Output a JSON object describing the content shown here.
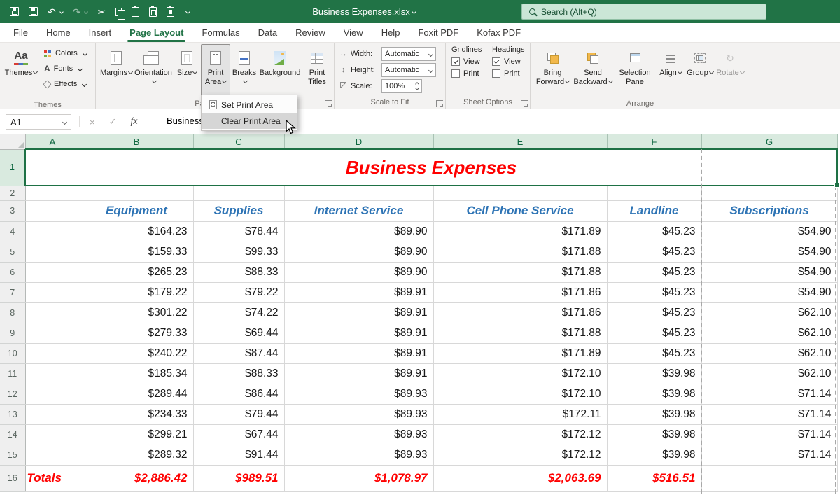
{
  "titlebar": {
    "title": "Business Expenses.xlsx",
    "search_placeholder": "Search (Alt+Q)"
  },
  "tabs": [
    "File",
    "Home",
    "Insert",
    "Page Layout",
    "Formulas",
    "Data",
    "Review",
    "View",
    "Help",
    "Foxit PDF",
    "Kofax PDF"
  ],
  "active_tab": "Page Layout",
  "icons": {
    "themes_aa": "Aa",
    "undo": "↶",
    "redo": "↷",
    "cut": "✂",
    "fonts": "A",
    "width_arrow": "↔",
    "height_arrow": "↕",
    "rotate": "↻",
    "cancel": "×",
    "enter": "✓"
  },
  "ribbon": {
    "themes": {
      "group_label": "Themes",
      "themes_button": "Themes",
      "colors": "Colors",
      "fonts": "Fonts",
      "effects": "Effects"
    },
    "page_setup": {
      "group_label": "Page Setup",
      "margins": "Margins",
      "orientation": "Orientation",
      "size": "Size",
      "print_area": "Print Area",
      "breaks": "Breaks",
      "background": "Background",
      "print_titles": "Print Titles"
    },
    "scale_to_fit": {
      "group_label": "Scale to Fit",
      "width_label": "Width:",
      "width_value": "Automatic",
      "height_label": "Height:",
      "height_value": "Automatic",
      "scale_label": "Scale:",
      "scale_value": "100%"
    },
    "sheet_options": {
      "group_label": "Sheet Options",
      "gridlines_label": "Gridlines",
      "headings_label": "Headings",
      "view_label": "View",
      "print_label": "Print",
      "gridlines_view_checked": true,
      "gridlines_print_checked": false,
      "headings_view_checked": true,
      "headings_print_checked": false
    },
    "arrange": {
      "group_label": "Arrange",
      "bring_forward": "Bring Forward",
      "send_backward": "Send Backward",
      "selection_pane": "Selection Pane",
      "align": "Align",
      "group": "Group",
      "rotate": "Rotate"
    }
  },
  "formula_bar": {
    "name_box": "A1",
    "fx": "fx",
    "value": "Business Expenses"
  },
  "print_area_menu": {
    "items": [
      {
        "accel": "S",
        "rest": "et Print Area",
        "highlighted": false
      },
      {
        "accel": "C",
        "rest": "lear Print Area",
        "highlighted": true
      }
    ]
  },
  "sheet": {
    "columns": [
      "A",
      "B",
      "C",
      "D",
      "E",
      "F",
      "G"
    ],
    "rows": [
      {
        "num": "1",
        "type": "title",
        "selected": true,
        "cells": [
          "Business Expenses"
        ]
      },
      {
        "num": "2",
        "type": "blank",
        "cells": [
          "",
          "",
          "",
          "",
          "",
          "",
          ""
        ]
      },
      {
        "num": "3",
        "type": "colhead",
        "cells": [
          "",
          "Equipment",
          "Supplies",
          "Internet Service",
          "Cell Phone Service",
          "Landline",
          "Subscriptions"
        ]
      },
      {
        "num": "4",
        "type": "data",
        "cells": [
          "",
          "$164.23",
          "$78.44",
          "$89.90",
          "$171.89",
          "$45.23",
          "$54.90"
        ]
      },
      {
        "num": "5",
        "type": "data",
        "cells": [
          "",
          "$159.33",
          "$99.33",
          "$89.90",
          "$171.88",
          "$45.23",
          "$54.90"
        ]
      },
      {
        "num": "6",
        "type": "data",
        "cells": [
          "",
          "$265.23",
          "$88.33",
          "$89.90",
          "$171.88",
          "$45.23",
          "$54.90"
        ]
      },
      {
        "num": "7",
        "type": "data",
        "cells": [
          "",
          "$179.22",
          "$79.22",
          "$89.91",
          "$171.86",
          "$45.23",
          "$54.90"
        ]
      },
      {
        "num": "8",
        "type": "data",
        "cells": [
          "",
          "$301.22",
          "$74.22",
          "$89.91",
          "$171.86",
          "$45.23",
          "$62.10"
        ]
      },
      {
        "num": "9",
        "type": "data",
        "cells": [
          "",
          "$279.33",
          "$69.44",
          "$89.91",
          "$171.88",
          "$45.23",
          "$62.10"
        ]
      },
      {
        "num": "10",
        "type": "data",
        "cells": [
          "",
          "$240.22",
          "$87.44",
          "$89.91",
          "$171.89",
          "$45.23",
          "$62.10"
        ]
      },
      {
        "num": "11",
        "type": "data",
        "cells": [
          "",
          "$185.34",
          "$88.33",
          "$89.91",
          "$172.10",
          "$39.98",
          "$62.10"
        ]
      },
      {
        "num": "12",
        "type": "data",
        "cells": [
          "",
          "$289.44",
          "$86.44",
          "$89.93",
          "$172.10",
          "$39.98",
          "$71.14"
        ]
      },
      {
        "num": "13",
        "type": "data",
        "cells": [
          "",
          "$234.33",
          "$79.44",
          "$89.93",
          "$172.11",
          "$39.98",
          "$71.14"
        ]
      },
      {
        "num": "14",
        "type": "data",
        "cells": [
          "",
          "$299.21",
          "$67.44",
          "$89.93",
          "$172.12",
          "$39.98",
          "$71.14"
        ]
      },
      {
        "num": "15",
        "type": "data",
        "cells": [
          "",
          "$289.32",
          "$91.44",
          "$89.93",
          "$172.12",
          "$39.98",
          "$71.14"
        ]
      },
      {
        "num": "16",
        "type": "totals",
        "cells": [
          "Totals",
          "$2,886.42",
          "$989.51",
          "$1,078.97",
          "$2,063.69",
          "$516.51",
          ""
        ]
      }
    ]
  },
  "colors": {
    "titlebar_green": "#217346",
    "selection_green": "#1E7145",
    "header_blue": "#2E74B5",
    "accent_red": "#FF0000"
  }
}
